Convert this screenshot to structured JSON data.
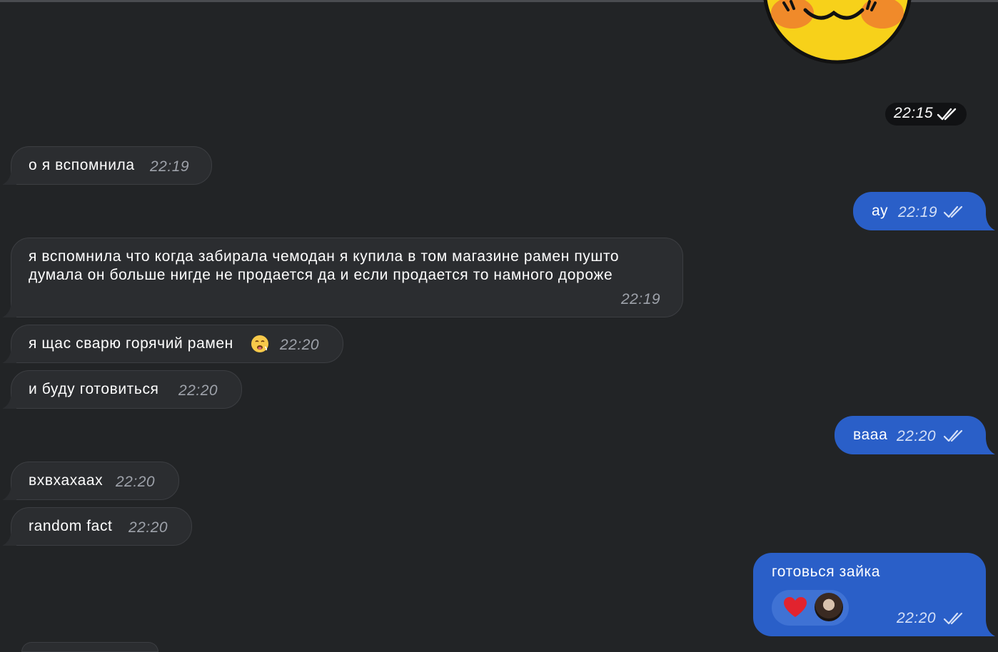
{
  "sticker": {
    "name": "smiling-sticker-icon",
    "time": "22:15"
  },
  "messages": [
    {
      "dir": "in",
      "text": "о я вспомнила",
      "time": "22:19"
    },
    {
      "dir": "out",
      "text": "ау",
      "time": "22:19"
    },
    {
      "dir": "in",
      "lines": [
        "я вспомнила что когда забирала чемодан я купила в том магазине рамен пушто",
        "думала он больше нигде не продается да и если продается то намного дороже"
      ],
      "time": "22:19"
    },
    {
      "dir": "in",
      "text": "я щас сварю горячий рамен",
      "emoji": "hot-face-emoji-icon",
      "time": "22:20"
    },
    {
      "dir": "in",
      "text": "и буду готовиться",
      "time": "22:20"
    },
    {
      "dir": "out",
      "text": "вааа",
      "time": "22:20"
    },
    {
      "dir": "in",
      "text": "вхвхахаах",
      "time": "22:20"
    },
    {
      "dir": "in",
      "text": "random fact",
      "time": "22:20"
    },
    {
      "dir": "out",
      "text": "готовься зайка",
      "time": "22:20",
      "reaction": {
        "emoji": "red-heart-icon",
        "avatar": "user-avatar"
      }
    }
  ]
}
